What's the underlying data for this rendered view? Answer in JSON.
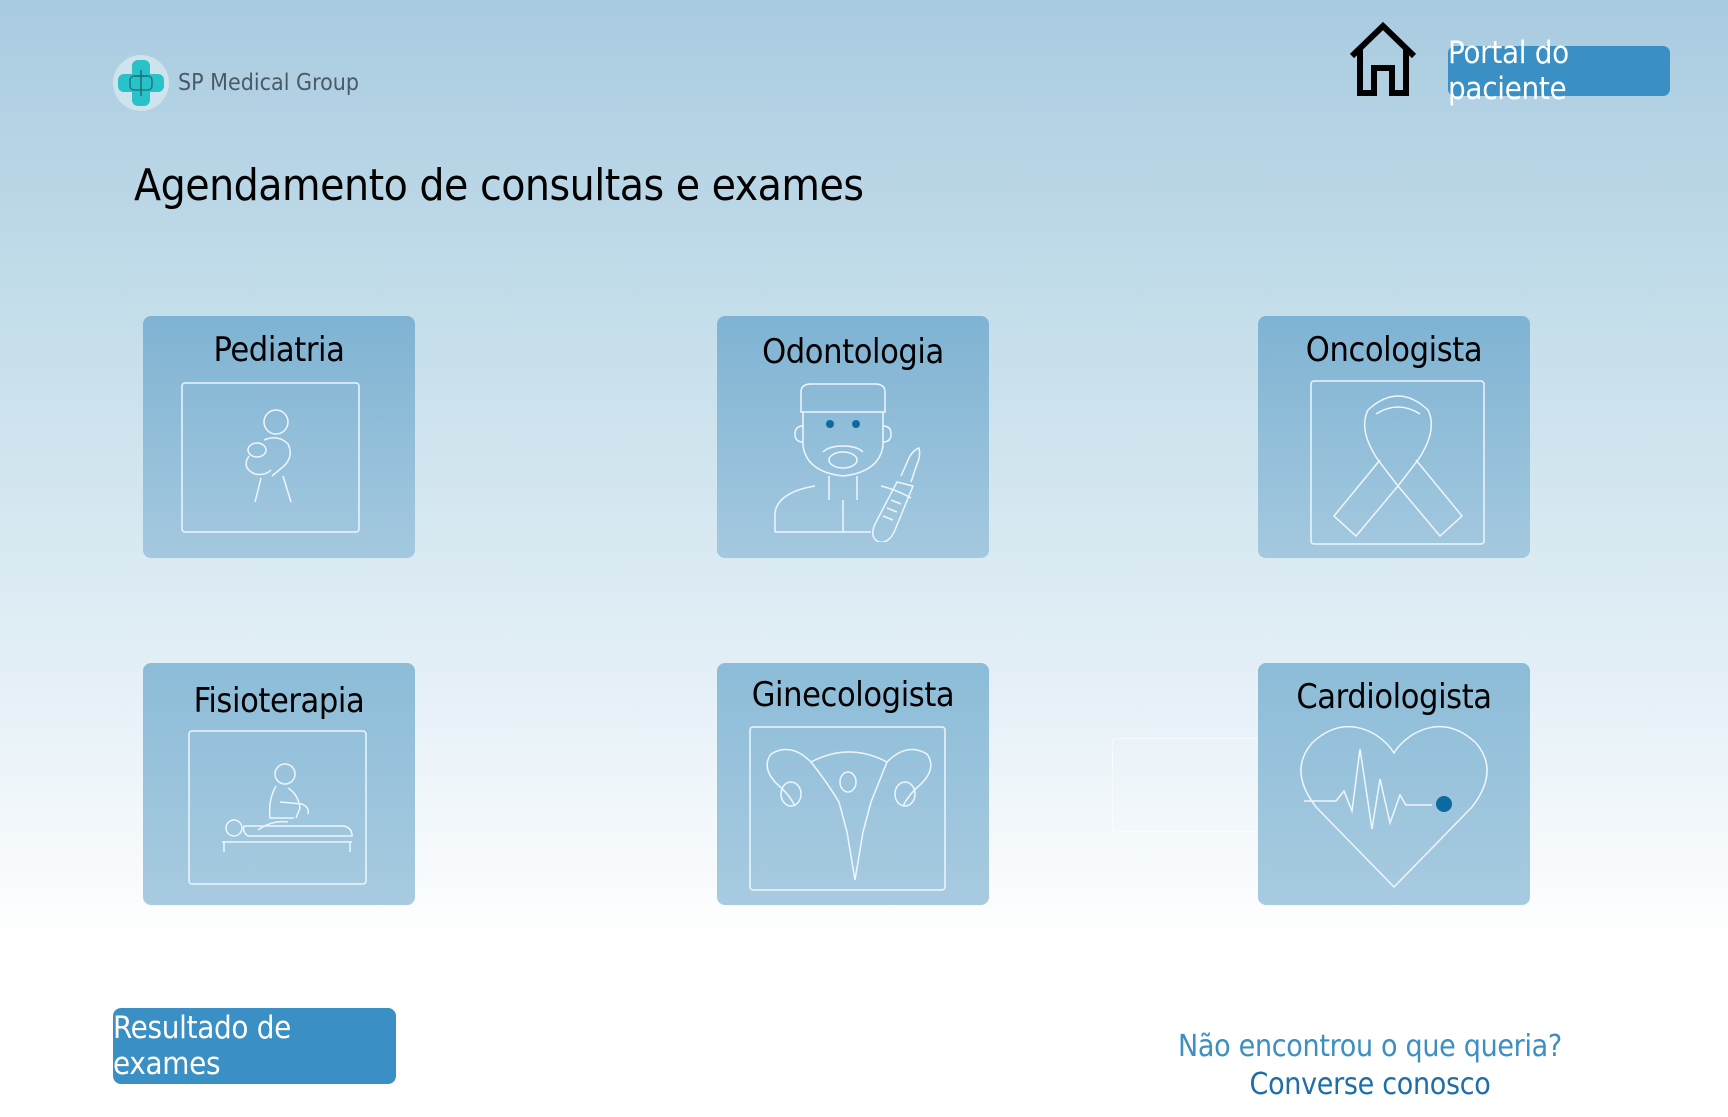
{
  "brand": {
    "name": "SP Medical Group",
    "icon": "medical-cross-logo"
  },
  "header": {
    "home_icon": "home-icon",
    "portal_label": "Portal do paciente"
  },
  "page": {
    "title": "Agendamento de consultas e exames"
  },
  "specialties": [
    {
      "label": "Pediatria",
      "icon": "pediatrics-icon"
    },
    {
      "label": "Odontologia",
      "icon": "dentist-icon"
    },
    {
      "label": "Oncologista",
      "icon": "cancer-ribbon-icon"
    },
    {
      "label": "Fisioterapia",
      "icon": "physiotherapy-icon"
    },
    {
      "label": "Ginecologista",
      "icon": "uterus-icon"
    },
    {
      "label": "Cardiologista",
      "icon": "heartbeat-icon"
    }
  ],
  "footer": {
    "results_label": "Resultado de exames",
    "help_question": "Não encontrou o que queria?",
    "help_link": "Converse conosco"
  },
  "colors": {
    "accent": "#3a8fc4",
    "card": "#7fb3d3",
    "icon_dot": "#0c6aa1",
    "logo": "#29c2c9"
  }
}
